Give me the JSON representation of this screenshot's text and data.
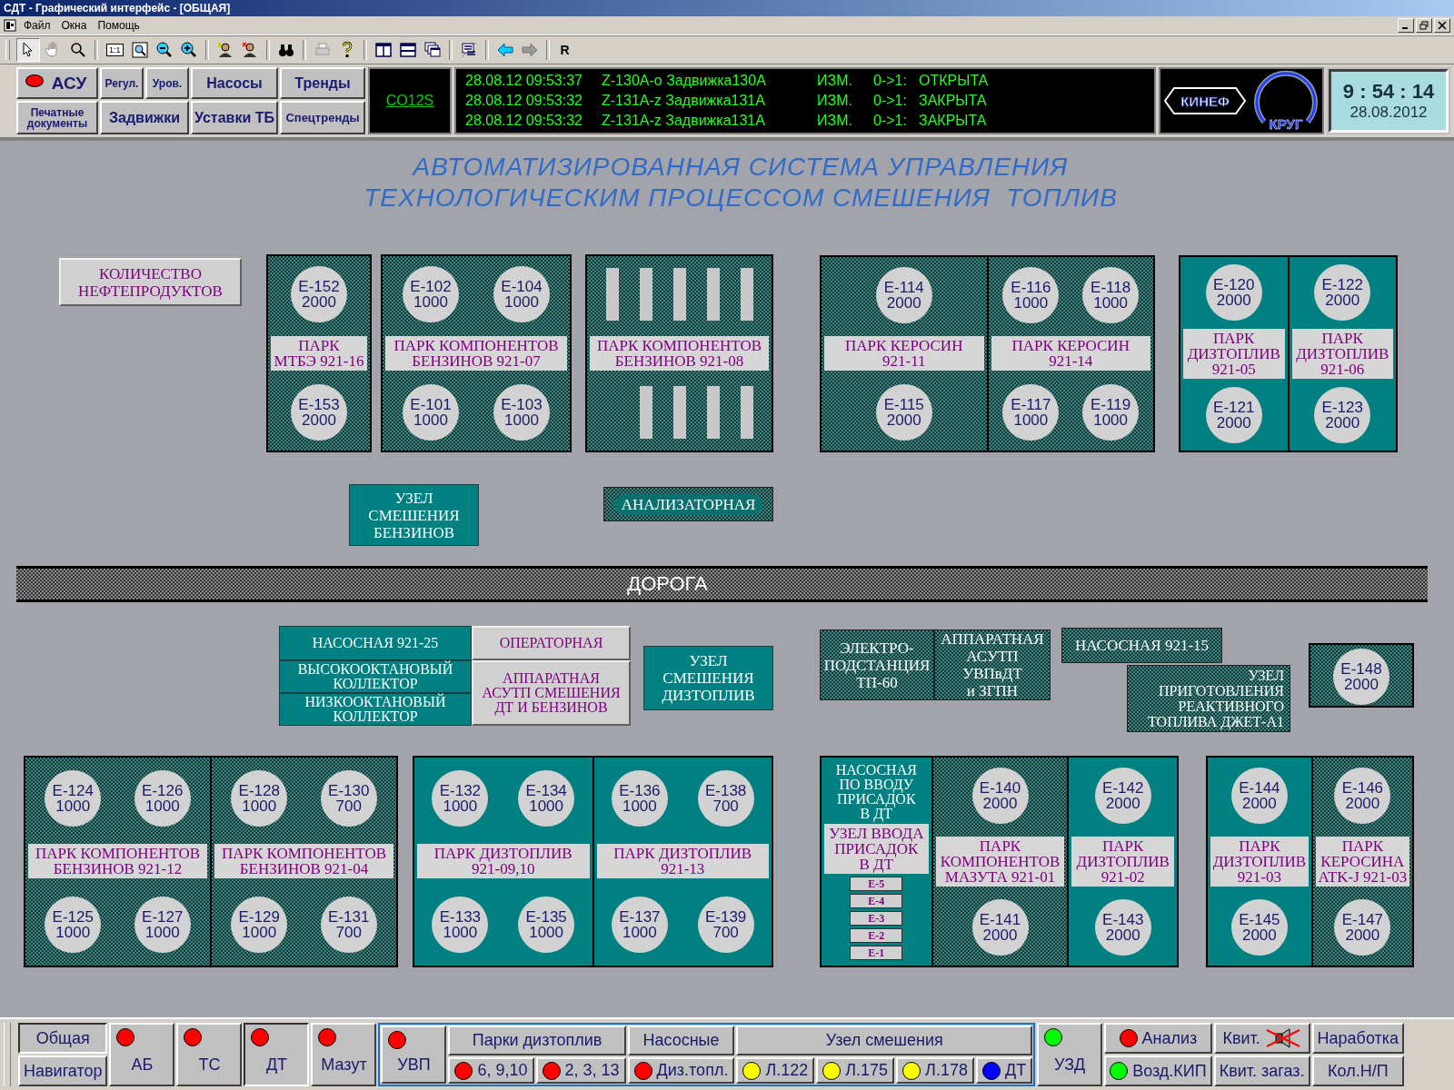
{
  "window": {
    "title": "СДТ - Графический интерфейс - [ОБЩАЯ]"
  },
  "menu": [
    "Файл",
    "Окна",
    "Помощь"
  ],
  "toolbar": {
    "scale_label": "1:1",
    "last_button": "R"
  },
  "top_nav": [
    {
      "label": "АСУ",
      "color": "#ff0000"
    },
    {
      "label": "Регул."
    },
    {
      "label": "Уров."
    },
    {
      "label": "Насосы"
    },
    {
      "label": "Тренды"
    },
    {
      "label": "Печатные документы"
    },
    {
      "label": "Задвижки"
    },
    {
      "label": "Уставки ТБ"
    },
    {
      "label": "Спецтренды"
    }
  ],
  "station_link": "CO12S",
  "event_log": [
    {
      "time": "28.08.12 09:53:37",
      "tag": "Z-130A-o Задвижка130A",
      "event": "ИЗМ.",
      "transition": "0->1:",
      "state": "ОТКРЫТА"
    },
    {
      "time": "28.08.12 09:53:32",
      "tag": "Z-131A-z Задвижка131A",
      "event": "ИЗМ.",
      "transition": "0->1:",
      "state": "ЗАКРЫТА"
    },
    {
      "time": "28.08.12 09:53:32",
      "tag": "Z-131A-z Задвижка131A",
      "event": "ИЗМ.",
      "transition": "0->1:",
      "state": "ЗАКРЫТА"
    }
  ],
  "logos": [
    "КИНЕФ",
    "КРУГ"
  ],
  "clock": {
    "time": "9 : 54 : 14",
    "date": "28.08.2012"
  },
  "canvas": {
    "title_lines": [
      "АВТОМАТИЗИРОВАННАЯ СИСТЕМА УПРАВЛЕНИЯ",
      "ТЕХНОЛОГИЧЕСКИМ ПРОЦЕССОМ СМЕШЕНИЯ  ТОПЛИВ"
    ],
    "blocks": [
      {
        "kind": "plain",
        "text": "КОЛИЧЕСТВО\nНЕФТЕПРОДУКТОВ"
      },
      {
        "kind": "park",
        "sections": [
          {
            "kind": "hatched",
            "parts": [
              {
                "kind": "tanks",
                "items": [
                  {
                    "kind": "round",
                    "name": "E-152",
                    "volume": "2000"
                  }
                ]
              },
              {
                "kind": "label",
                "text": "ПАРК\nМТБЭ 921-16"
              },
              {
                "kind": "tanks",
                "items": [
                  {
                    "kind": "round",
                    "name": "E-153",
                    "volume": "2000"
                  }
                ]
              }
            ]
          }
        ]
      },
      {
        "kind": "park",
        "sections": [
          {
            "kind": "hatched",
            "parts": [
              {
                "kind": "tanks",
                "items": [
                  {
                    "kind": "round",
                    "name": "E-102",
                    "volume": "1000"
                  },
                  {
                    "kind": "round",
                    "name": "E-104",
                    "volume": "1000"
                  }
                ]
              },
              {
                "kind": "label",
                "text": "ПАРК КОМПОНЕНТОВ\nБЕНЗИНОВ  921-07"
              },
              {
                "kind": "tanks",
                "items": [
                  {
                    "kind": "round",
                    "name": "E-101",
                    "volume": "1000"
                  },
                  {
                    "kind": "round",
                    "name": "E-103",
                    "volume": "1000"
                  }
                ]
              }
            ]
          }
        ]
      },
      {
        "kind": "park",
        "sections": [
          {
            "kind": "hatched",
            "parts": [
              {
                "kind": "tanks",
                "items": [
                  {
                    "kind": "bar"
                  },
                  {
                    "kind": "bar"
                  },
                  {
                    "kind": "bar"
                  },
                  {
                    "kind": "bar"
                  },
                  {
                    "kind": "bar"
                  }
                ]
              },
              {
                "kind": "label",
                "text": "ПАРК КОМПОНЕНТОВ\nБЕНЗИНОВ  921-08"
              },
              {
                "kind": "tanks",
                "items": [
                  {
                    "kind": "bar"
                  },
                  {
                    "kind": "bar"
                  },
                  {
                    "kind": "bar"
                  },
                  {
                    "kind": "bar"
                  }
                ]
              }
            ]
          }
        ]
      },
      {
        "kind": "park",
        "sections": [
          {
            "kind": "hatched",
            "parts": [
              {
                "kind": "tanks",
                "items": [
                  {
                    "kind": "round",
                    "name": "E-114",
                    "volume": "2000"
                  }
                ]
              },
              {
                "kind": "label",
                "text": "ПАРК КЕРОСИН\n921-11"
              },
              {
                "kind": "tanks",
                "items": [
                  {
                    "kind": "round",
                    "name": "E-115",
                    "volume": "2000"
                  }
                ]
              }
            ]
          },
          {
            "kind": "hatched",
            "parts": [
              {
                "kind": "tanks",
                "items": [
                  {
                    "kind": "round",
                    "name": "E-116",
                    "volume": "1000"
                  },
                  {
                    "kind": "round",
                    "name": "E-118",
                    "volume": "1000"
                  }
                ]
              },
              {
                "kind": "label",
                "text": "ПАРК КЕРОСИН\n921-14"
              },
              {
                "kind": "tanks",
                "items": [
                  {
                    "kind": "round",
                    "name": "E-117",
                    "volume": "1000"
                  },
                  {
                    "kind": "round",
                    "name": "E-119",
                    "volume": "1000"
                  }
                ]
              }
            ]
          }
        ]
      },
      {
        "kind": "park",
        "sections": [
          {
            "kind": "teal",
            "parts": [
              {
                "kind": "tanks",
                "items": [
                  {
                    "kind": "round",
                    "name": "E-120",
                    "volume": "2000"
                  }
                ]
              },
              {
                "kind": "label",
                "text": "ПАРК\nДИЗТОПЛИВ\n921-05"
              },
              {
                "kind": "tanks",
                "items": [
                  {
                    "kind": "round",
                    "name": "E-121",
                    "volume": "2000"
                  }
                ]
              }
            ]
          },
          {
            "kind": "teal",
            "parts": [
              {
                "kind": "tanks",
                "items": [
                  {
                    "kind": "round",
                    "name": "E-122",
                    "volume": "2000"
                  }
                ]
              },
              {
                "kind": "label",
                "text": "ПАРК\nДИЗТОПЛИВ\n921-06"
              },
              {
                "kind": "tanks",
                "items": [
                  {
                    "kind": "round",
                    "name": "E-123",
                    "volume": "2000"
                  }
                ]
              }
            ]
          }
        ]
      },
      {
        "kind": "teal",
        "text": "УЗЕЛ\nСМЕШЕНИЯ\nБЕНЗИНОВ"
      },
      {
        "kind": "badge",
        "text": "АНАЛИЗАТОРНАЯ"
      },
      {
        "kind": "road",
        "text": "ДОРОГА"
      },
      {
        "kind": "complex",
        "columns": [
          [
            {
              "kind": "teal",
              "text": "НАСОСНАЯ 921-25"
            },
            {
              "kind": "teal",
              "text": "ВЫСОКООКТАНОВЫЙ\nКОЛЛЕКТОР"
            },
            {
              "kind": "teal",
              "text": "НИЗКООКТАНОВЫЙ\nКОЛЛЕКТОР"
            }
          ],
          [
            {
              "kind": "plain",
              "text": "ОПЕРАТОРНАЯ"
            },
            {
              "kind": "plain",
              "text": "АППАРАТНАЯ\nАСУТП СМЕШЕНИЯ\nДТ И БЕНЗИНОВ"
            }
          ]
        ]
      },
      {
        "kind": "teal",
        "text": "УЗЕЛ\nСМЕШЕНИЯ\nДИЗТОПЛИВ"
      },
      {
        "kind": "hatched",
        "text": "ЭЛЕКТРО-\nПОДСТАНЦИЯ\nТП-60"
      },
      {
        "kind": "hatched",
        "text": "АППАРАТНАЯ\nАСУТП\nУВПвДТ\nи ЗГПН"
      },
      {
        "kind": "hatched",
        "text": "НАСОСНАЯ 921-15"
      },
      {
        "kind": "offset",
        "text": "УЗЕЛ\nПРИГОТОВЛЕНИЯ\nРЕАКТИВНОГО\nТОПЛИВА ДЖЕТ-А1"
      },
      {
        "kind": "park",
        "sections": [
          {
            "kind": "hatched",
            "parts": [
              {
                "kind": "tanks",
                "items": [
                  {
                    "kind": "round",
                    "name": "E-148",
                    "volume": "2000"
                  }
                ]
              }
            ]
          }
        ]
      },
      {
        "kind": "park",
        "sections": [
          {
            "kind": "hatched",
            "parts": [
              {
                "kind": "tanks",
                "items": [
                  {
                    "kind": "round",
                    "name": "E-124",
                    "volume": "1000"
                  },
                  {
                    "kind": "round",
                    "name": "E-126",
                    "volume": "1000"
                  }
                ]
              },
              {
                "kind": "label",
                "text": "ПАРК КОМПОНЕНТОВ\nБЕНЗИНОВ  921-12"
              },
              {
                "kind": "tanks",
                "items": [
                  {
                    "kind": "round",
                    "name": "E-125",
                    "volume": "1000"
                  },
                  {
                    "kind": "round",
                    "name": "E-127",
                    "volume": "1000"
                  }
                ]
              }
            ]
          },
          {
            "kind": "hatched",
            "parts": [
              {
                "kind": "tanks",
                "items": [
                  {
                    "kind": "round",
                    "name": "E-128",
                    "volume": "1000"
                  },
                  {
                    "kind": "round",
                    "name": "E-130",
                    "volume": "700"
                  }
                ]
              },
              {
                "kind": "label",
                "text": "ПАРК КОМПОНЕНТОВ\nБЕНЗИНОВ  921-04"
              },
              {
                "kind": "tanks",
                "items": [
                  {
                    "kind": "round",
                    "name": "E-129",
                    "volume": "1000"
                  },
                  {
                    "kind": "round",
                    "name": "E-131",
                    "volume": "700"
                  }
                ]
              }
            ]
          }
        ]
      },
      {
        "kind": "park",
        "sections": [
          {
            "kind": "teal",
            "parts": [
              {
                "kind": "tanks",
                "items": [
                  {
                    "kind": "round",
                    "name": "E-132",
                    "volume": "1000"
                  },
                  {
                    "kind": "round",
                    "name": "E-134",
                    "volume": "1000"
                  }
                ]
              },
              {
                "kind": "label",
                "text": "ПАРК ДИЗТОПЛИВ\n921-09,10"
              },
              {
                "kind": "tanks",
                "items": [
                  {
                    "kind": "round",
                    "name": "E-133",
                    "volume": "1000"
                  },
                  {
                    "kind": "round",
                    "name": "E-135",
                    "volume": "1000"
                  }
                ]
              }
            ]
          },
          {
            "kind": "teal",
            "parts": [
              {
                "kind": "tanks",
                "items": [
                  {
                    "kind": "round",
                    "name": "E-136",
                    "volume": "1000"
                  },
                  {
                    "kind": "round",
                    "name": "E-138",
                    "volume": "700"
                  }
                ]
              },
              {
                "kind": "label",
                "text": "ПАРК ДИЗТОПЛИВ\n921-13"
              },
              {
                "kind": "tanks",
                "items": [
                  {
                    "kind": "round",
                    "name": "E-137",
                    "volume": "1000"
                  },
                  {
                    "kind": "round",
                    "name": "E-139",
                    "volume": "700"
                  }
                ]
              }
            ]
          }
        ]
      },
      {
        "kind": "park",
        "sections": [
          {
            "kind": "teal",
            "parts": [
              {
                "kind": "heading",
                "text": "НАСОСНАЯ\nПО ВВОДУ\nПРИСАДОК\nВ ДТ"
              },
              {
                "kind": "label",
                "text": "УЗЕЛ ВВОДА\nПРИСАДОК\nВ ДТ"
              },
              {
                "kind": "keys",
                "items": [
                  "E-5",
                  "E-4",
                  "E-3",
                  "E-2",
                  "E-1"
                ]
              }
            ]
          },
          {
            "kind": "hatched",
            "parts": [
              {
                "kind": "tanks",
                "items": [
                  {
                    "kind": "round",
                    "name": "E-140",
                    "volume": "2000"
                  }
                ]
              },
              {
                "kind": "label",
                "text": "ПАРК\nКОМПОНЕНТОВ\nМАЗУТА 921-01"
              },
              {
                "kind": "tanks",
                "items": [
                  {
                    "kind": "round",
                    "name": "E-141",
                    "volume": "2000"
                  }
                ]
              }
            ]
          },
          {
            "kind": "teal",
            "parts": [
              {
                "kind": "tanks",
                "items": [
                  {
                    "kind": "round",
                    "name": "E-142",
                    "volume": "2000"
                  }
                ]
              },
              {
                "kind": "label",
                "text": "ПАРК\nДИЗТОПЛИВ\n921-02"
              },
              {
                "kind": "tanks",
                "items": [
                  {
                    "kind": "round",
                    "name": "E-143",
                    "volume": "2000"
                  }
                ]
              }
            ]
          }
        ]
      },
      {
        "kind": "park",
        "sections": [
          {
            "kind": "teal",
            "parts": [
              {
                "kind": "tanks",
                "items": [
                  {
                    "kind": "round",
                    "name": "E-144",
                    "volume": "2000"
                  }
                ]
              },
              {
                "kind": "label",
                "text": "ПАРК\nДИЗТОПЛИВ\n921-03"
              },
              {
                "kind": "tanks",
                "items": [
                  {
                    "kind": "round",
                    "name": "E-145",
                    "volume": "2000"
                  }
                ]
              }
            ]
          },
          {
            "kind": "hatched",
            "parts": [
              {
                "kind": "tanks",
                "items": [
                  {
                    "kind": "round",
                    "name": "E-146",
                    "volume": "2000"
                  }
                ]
              },
              {
                "kind": "label",
                "text": "ПАРК\nКЕРОСИНА\nATK-J  921-03"
              },
              {
                "kind": "tanks",
                "items": [
                  {
                    "kind": "round",
                    "name": "E-147",
                    "volume": "2000"
                  }
                ]
              }
            ]
          }
        ]
      }
    ]
  },
  "bottom_bar": [
    {
      "kind": "pair",
      "buttons": [
        {
          "label": "Общая",
          "selected": true
        },
        {
          "label": "Навигатор",
          "selected": false
        }
      ]
    },
    {
      "kind": "lamp",
      "label": "АБ",
      "color": "#ff0000",
      "selected": false
    },
    {
      "kind": "lamp",
      "label": "ТС",
      "color": "#ff0000",
      "selected": false
    },
    {
      "kind": "lamp",
      "label": "ДТ",
      "color": "#ff0000",
      "selected": true
    },
    {
      "kind": "lamp",
      "label": "Мазут",
      "color": "#ff0000",
      "selected": false
    },
    {
      "kind": "group",
      "items": [
        {
          "kind": "lamp",
          "label": "УВП",
          "color": "#ff0000",
          "selected": false
        },
        {
          "kind": "panel",
          "title": "Парки дизтоплив",
          "buttons": [
            {
              "label": "6, 9,10",
              "color": "#ff0000"
            },
            {
              "label": "2, 3, 13",
              "color": "#ff0000"
            }
          ]
        },
        {
          "kind": "panel",
          "title": "Насосные",
          "buttons": [
            {
              "label": "Диз.топл.",
              "color": "#ff0000"
            }
          ]
        },
        {
          "kind": "panel",
          "title": "Узел смешения",
          "buttons": [
            {
              "label": "Л.122",
              "color": "#ffff00"
            },
            {
              "label": "Л.175",
              "color": "#ffff00"
            },
            {
              "label": "Л.178",
              "color": "#ffff00"
            },
            {
              "label": "ДТ",
              "color": "#0000ff"
            }
          ]
        }
      ]
    },
    {
      "kind": "lamp",
      "label": "УЗД",
      "color": "#00ff00",
      "selected": false
    },
    {
      "kind": "pair",
      "buttons": [
        {
          "label": "Анализ",
          "color": "#ff0000",
          "selected": false
        },
        {
          "label": "Возд.КИП",
          "color": "#00ff00",
          "selected": false
        }
      ]
    },
    {
      "kind": "pair",
      "buttons": [
        {
          "label": "Квит.",
          "muted": true,
          "selected": false
        },
        {
          "label": "Квит. загаз.",
          "selected": false
        }
      ]
    },
    {
      "kind": "pair",
      "buttons": [
        {
          "label": "Наработка",
          "selected": false
        },
        {
          "label": "Кол.Н/П",
          "selected": false
        }
      ]
    }
  ]
}
